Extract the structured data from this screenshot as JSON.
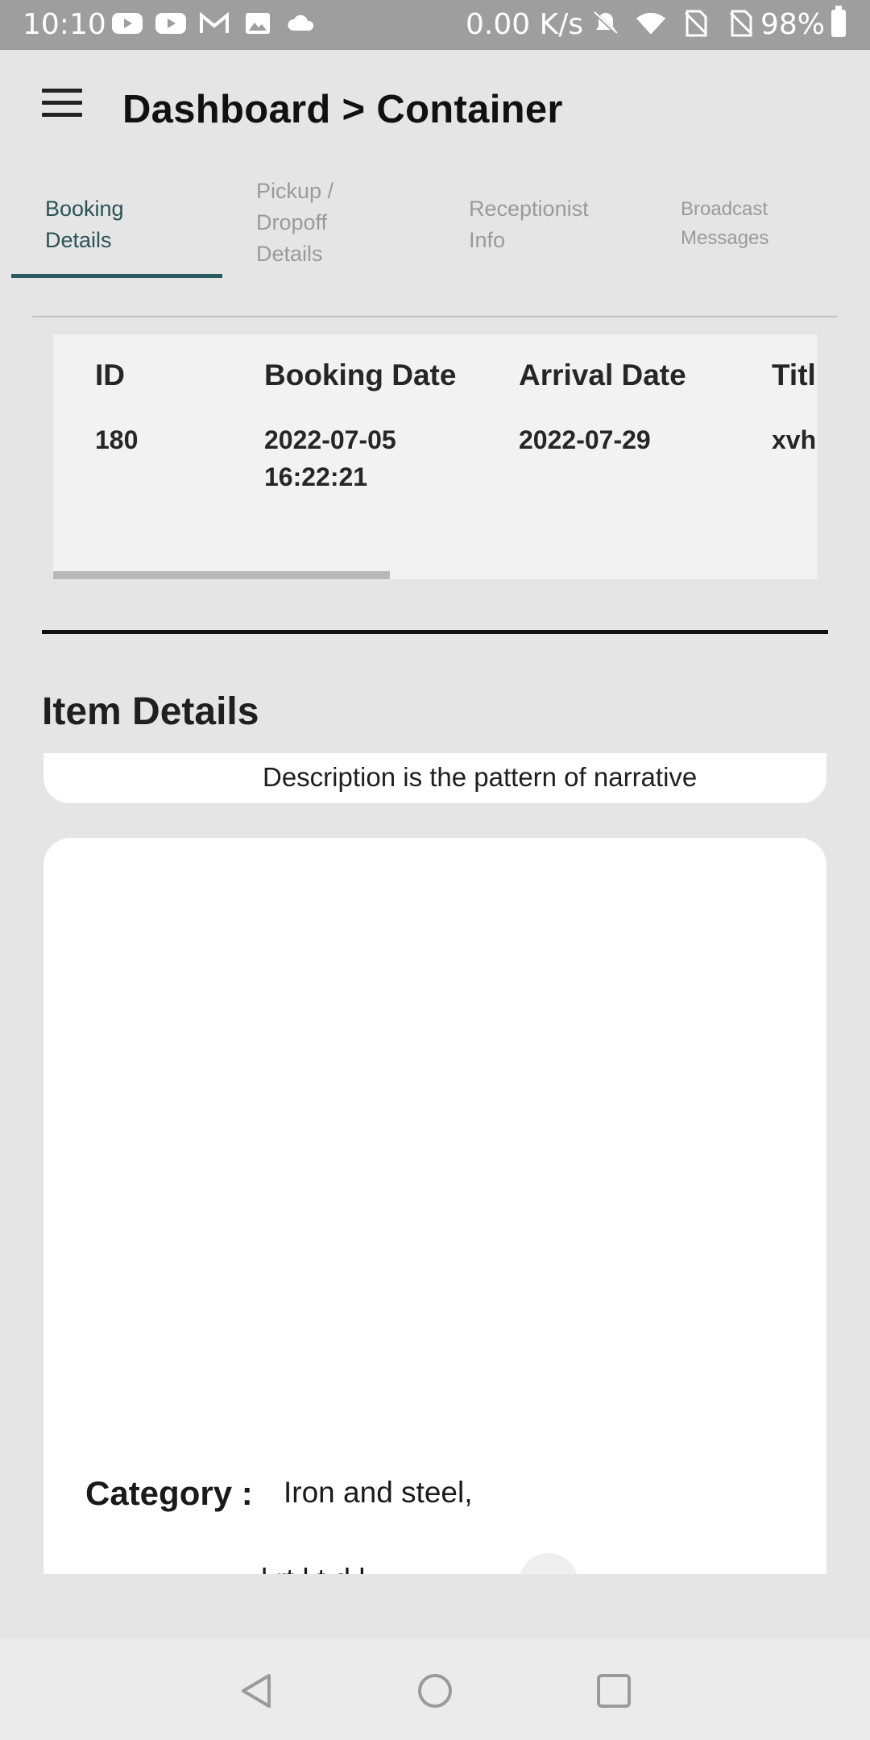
{
  "status_bar": {
    "time": "10:10",
    "net_speed": "0.00 K/s",
    "battery": "98%",
    "left_icons": [
      "youtube-icon",
      "youtube-icon",
      "gmail-icon",
      "image-icon",
      "cloud-icon"
    ],
    "right_icons": [
      "bell-muted-icon",
      "wifi-icon",
      "no-sim-icon",
      "no-sim-icon",
      "battery-icon"
    ]
  },
  "header": {
    "title": "Dashboard > Container"
  },
  "tabs": [
    {
      "label_line1": "Booking",
      "label_line2": "Details",
      "label_line3": "",
      "active": true
    },
    {
      "label_line1": "Pickup /",
      "label_line2": "Dropoff",
      "label_line3": "Details",
      "active": false
    },
    {
      "label_line1": "Receptionist",
      "label_line2": "Info",
      "label_line3": "",
      "active": false
    },
    {
      "label_line1": "Broadcast",
      "label_line2": "Messages",
      "label_line3": "",
      "active": false
    }
  ],
  "table": {
    "headers": [
      "ID",
      "Booking Date",
      "Arrival Date",
      "Titl"
    ],
    "row": {
      "id": "180",
      "booking_date_line1": "2022-07-05",
      "booking_date_line2": "16:22:21",
      "arrival_date": "2022-07-29",
      "title": "xvh"
    }
  },
  "item_details": {
    "title": "Item Details",
    "description": "Description is the pattern of narrative",
    "category_label": "Category :",
    "category_value": "Iron and steel,",
    "cut_text": "l   rt    l t d l"
  },
  "colors": {
    "accent": "#2b5a5e",
    "status_bar": "#9e9e9e",
    "background": "#e5e5e5"
  }
}
